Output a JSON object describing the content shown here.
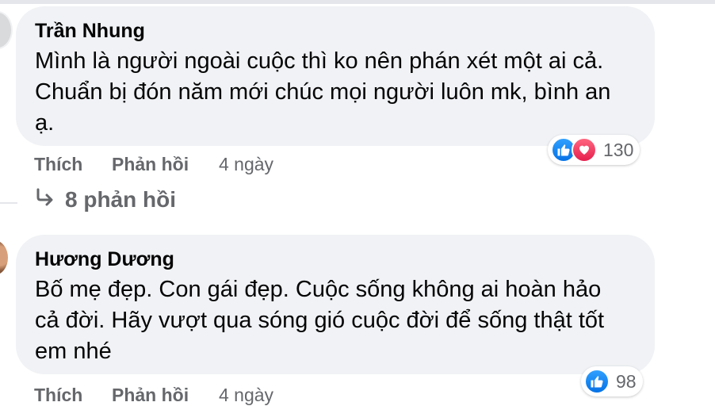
{
  "comments": [
    {
      "author": "Trần Nhung",
      "lines": [
        "Mình là người ngoài cuộc thì ko nên phán xét một ai cả.",
        "Chuẩn bị đón năm mới chúc mọi người luôn mk, bình an",
        "ạ."
      ],
      "like_label": "Thích",
      "reply_label": "Phản hồi",
      "time": "4 ngày",
      "reactions": [
        "like-icon",
        "love-icon"
      ],
      "reaction_count": "130"
    },
    {
      "author": "Hương Dương",
      "lines": [
        "Bố mẹ đẹp. Con gái đẹp. Cuộc sống không ai hoàn hảo",
        "cả đời. Hãy vượt qua sóng gió cuộc đời để sống thật tốt",
        "em nhé"
      ],
      "like_label": "Thích",
      "reply_label": "Phản hồi",
      "time": "4 ngày",
      "reactions": [
        "like-icon"
      ],
      "reaction_count": "98"
    }
  ],
  "replies_link": "8 phản hồi",
  "colors": {
    "bubble": "#f0f2f5",
    "secondary_text": "#65676b",
    "like_blue": "#0572e6",
    "love_red": "#e61e4d"
  }
}
